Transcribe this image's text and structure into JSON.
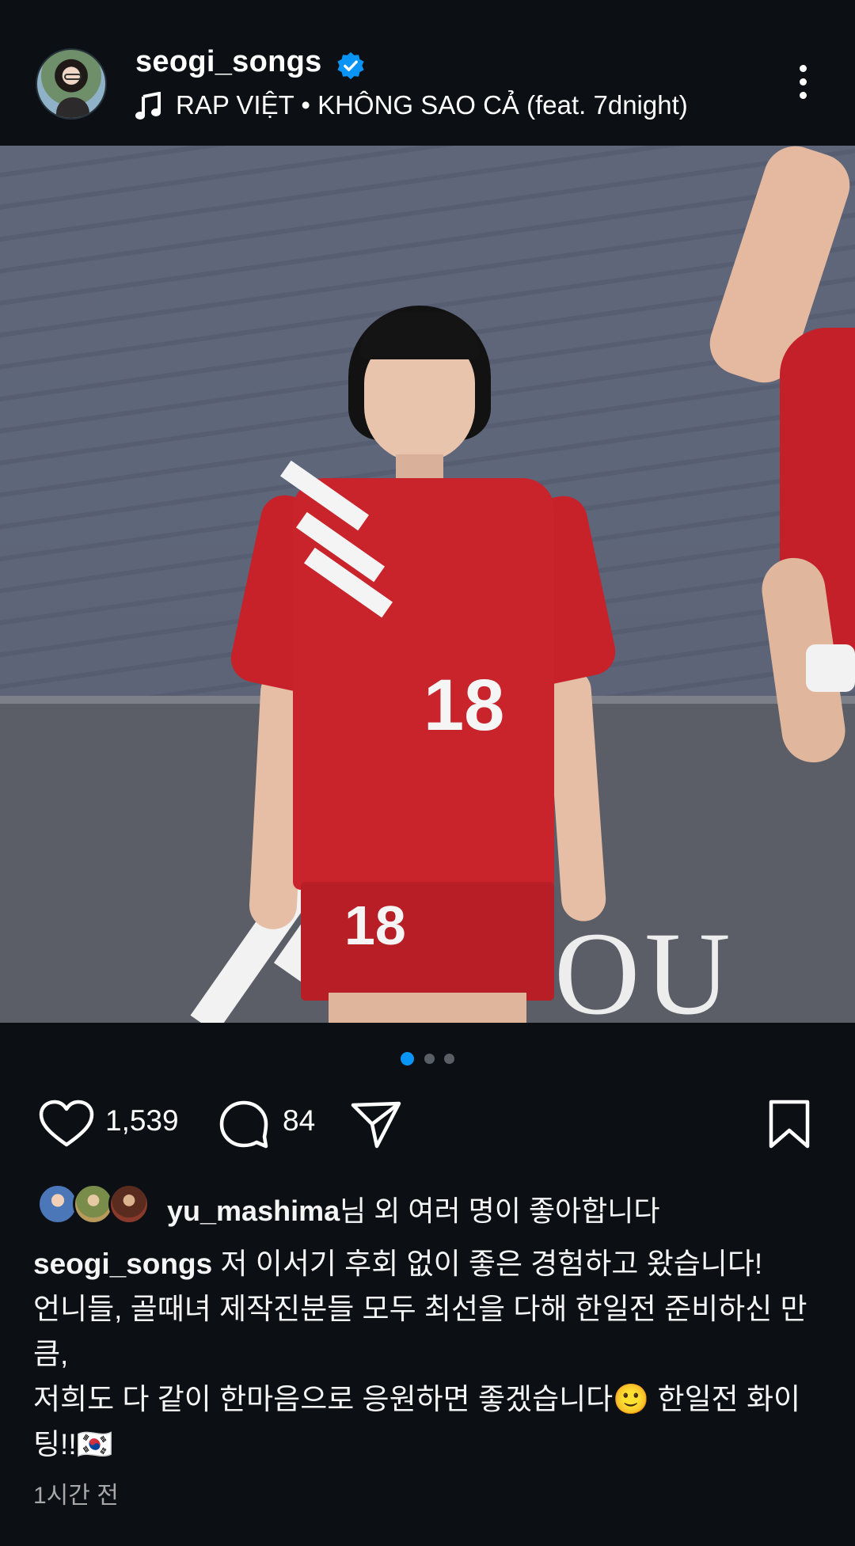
{
  "header": {
    "username": "seogi_songs",
    "verified": true,
    "music": "RAP VIỆT • KHÔNG SAO CẢ (feat. 7dnight)",
    "icons": {
      "verified": "verified-badge-icon",
      "music": "music-note-icon",
      "more": "more-options-icon"
    }
  },
  "media": {
    "jersey_number": "18",
    "shorts_number": "18",
    "sign_text": "OU G",
    "carousel": {
      "count": 3,
      "active": 0
    },
    "mute_icon": "speaker-muted-icon"
  },
  "actions": {
    "likes": "1,539",
    "comments": "84",
    "icons": {
      "like": "heart-icon",
      "comment": "comment-icon",
      "share": "send-icon",
      "save": "bookmark-icon"
    }
  },
  "liked_by": {
    "user": "yu_mashima",
    "suffix": "님 외 여러 명이 좋아합니다"
  },
  "caption": {
    "user": "seogi_songs",
    "line1": " 저 이서기 후회 없이 좋은 경험하고 왔습니다!",
    "line2": "언니들, 골때녀 제작진분들 모두 최선을 다해 한일전 준비하신 만큼,",
    "line3": "저희도 다 같이 한마음으로 응원하면 좋겠습니다🙂 한일전 화이팅!!🇰🇷"
  },
  "timestamp": "1시간 전",
  "colors": {
    "background": "#0c1014",
    "accent": "#0a95f6",
    "verified": "#0a95f6",
    "muted_text": "#a8a8a8"
  }
}
